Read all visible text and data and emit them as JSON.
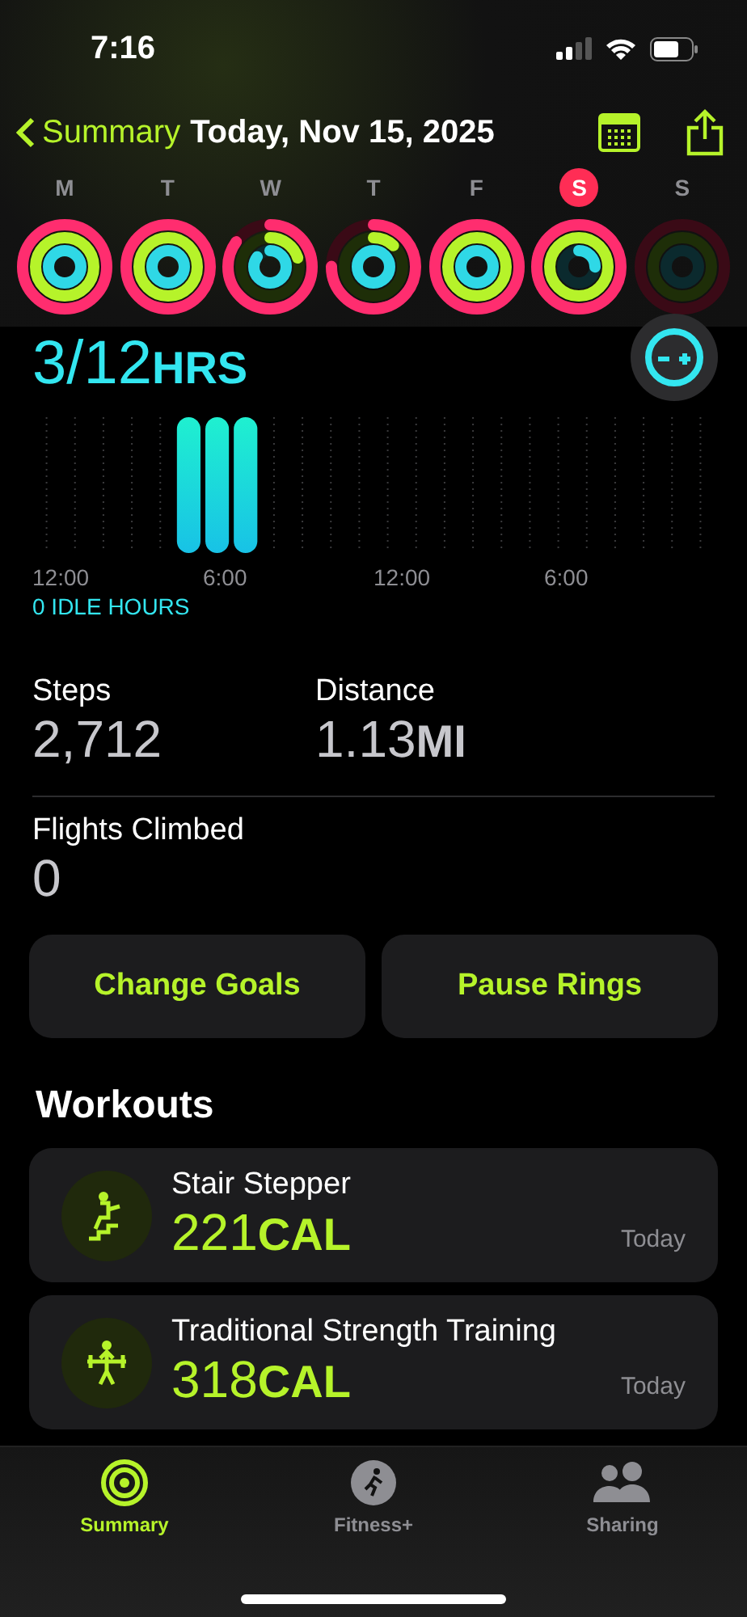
{
  "status_bar": {
    "time": "7:16"
  },
  "nav": {
    "back_label": "Summary",
    "title": "Today, Nov 15, 2025"
  },
  "days": [
    {
      "letter": "M",
      "selected": false
    },
    {
      "letter": "T",
      "selected": false
    },
    {
      "letter": "W",
      "selected": false
    },
    {
      "letter": "T",
      "selected": false
    },
    {
      "letter": "F",
      "selected": false
    },
    {
      "letter": "S",
      "selected": true
    },
    {
      "letter": "S",
      "selected": false
    }
  ],
  "stand": {
    "value": "3/12",
    "unit": "HRS",
    "idle": "0 IDLE HOURS",
    "axis_labels": [
      "12:00",
      "6:00",
      "12:00",
      "6:00"
    ]
  },
  "stats": [
    {
      "label": "Steps",
      "value": "2,712"
    },
    {
      "label": "Distance",
      "value": "1.13",
      "unit": "MI"
    },
    {
      "label": "Flights Climbed",
      "value": "0"
    }
  ],
  "buttons": [
    "Change Goals",
    "Pause Rings"
  ],
  "workouts": {
    "title": "Workouts",
    "items": [
      {
        "kind": "stair",
        "name": "Stair Stepper",
        "value": "221",
        "unit": "CAL",
        "date": "Today"
      },
      {
        "kind": "strength",
        "name": "Traditional Strength Training",
        "value": "318",
        "unit": "CAL",
        "date": "Today"
      }
    ]
  },
  "tab_bar": [
    {
      "kind": "summary",
      "label": "Summary",
      "selected": true
    },
    {
      "kind": "fitness",
      "label": "Fitness+",
      "selected": false
    },
    {
      "kind": "sharing",
      "label": "Sharing",
      "selected": false
    }
  ]
}
